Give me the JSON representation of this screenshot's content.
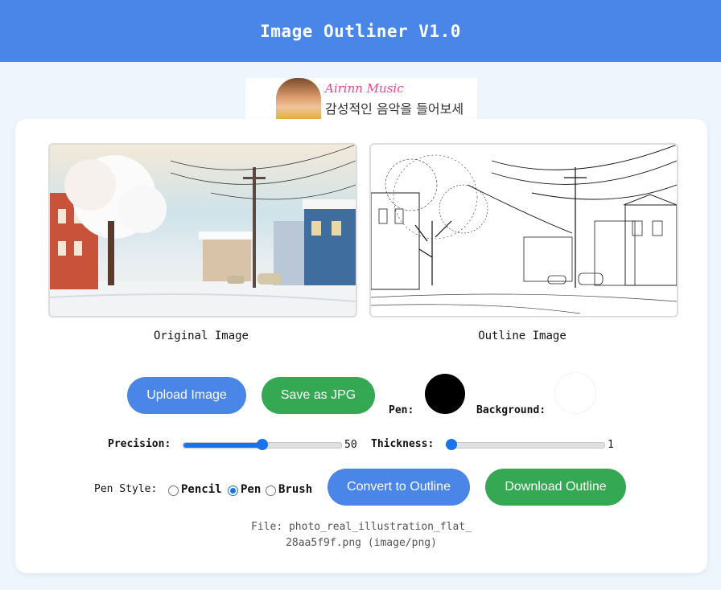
{
  "app": {
    "title": "Image Outliner V1.0"
  },
  "ad": {
    "brand": "Airinn Music",
    "tagline": "감성적인 음악을 들어보세요."
  },
  "images": {
    "original_caption": "Original Image",
    "outline_caption": "Outline Image"
  },
  "buttons": {
    "upload": "Upload Image",
    "save_jpg": "Save as JPG",
    "convert": "Convert to Outline",
    "download": "Download Outline"
  },
  "colors": {
    "pen_label": "Pen:",
    "pen_color": "#000000",
    "background_label": "Background:",
    "background_color": "#ffffff",
    "accent": "#4a86e8",
    "green": "#34a853"
  },
  "sliders": {
    "precision": {
      "label": "Precision:",
      "value": "50",
      "min": 0,
      "max": 100,
      "level": 0.5
    },
    "thickness": {
      "label": "Thickness:",
      "value": "1",
      "min": 1,
      "max": 10,
      "level": 0.0
    }
  },
  "pen_style": {
    "label": "Pen Style:",
    "options": [
      "Pencil",
      "Pen",
      "Brush"
    ],
    "selected": "Pen"
  },
  "file": {
    "label": "File:",
    "name_line1": "photo_real_illustration_flat_",
    "name_line2": "28aa5f9f.png (image/png)"
  }
}
